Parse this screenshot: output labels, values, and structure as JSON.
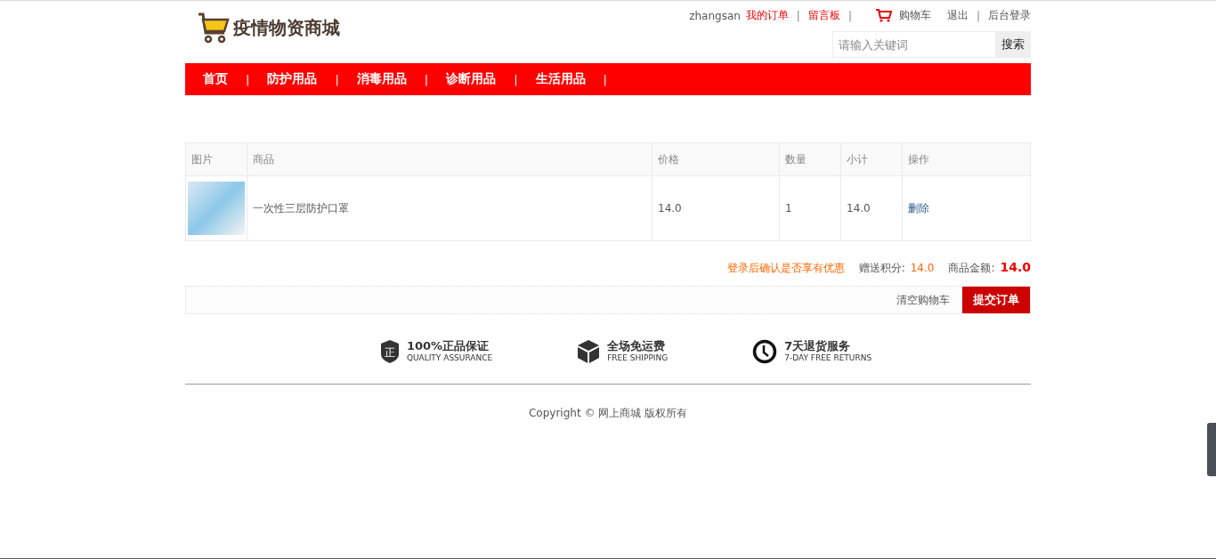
{
  "logo": {
    "title": "疫情物资商城"
  },
  "top_links": [
    {
      "kind": "user",
      "label": "zhangsan"
    },
    {
      "kind": "red",
      "label": "我的订单"
    },
    {
      "kind": "sep",
      "label": "|"
    },
    {
      "kind": "red",
      "label": "留言板"
    },
    {
      "kind": "sep",
      "label": "|"
    },
    {
      "kind": "cart",
      "label": "购物车"
    },
    {
      "kind": "link",
      "label": "退出"
    },
    {
      "kind": "sep",
      "label": "|"
    },
    {
      "kind": "link",
      "label": "后台登录"
    }
  ],
  "search": {
    "placeholder": "请输入关键词",
    "button": "搜索"
  },
  "nav": {
    "separator": "|",
    "items": [
      {
        "label": "首页"
      },
      {
        "label": "防护用品"
      },
      {
        "label": "消毒用品"
      },
      {
        "label": "诊断用品"
      },
      {
        "label": "生活用品"
      }
    ]
  },
  "table": {
    "columns": [
      "图片",
      "商品",
      "价格",
      "数量",
      "小计",
      "操作"
    ],
    "rows": [
      {
        "name": "一次性三层防护口罩",
        "price": "14.0",
        "quantity": "1",
        "subtotal": "14.0",
        "action": "删除"
      }
    ]
  },
  "summary": {
    "notice": "登录后确认是否享有优惠",
    "points_label": "赠送积分:",
    "points": "14.0",
    "total_label": "商品金额:",
    "total": "14.0"
  },
  "actions": {
    "clear": "清空购物车",
    "submit": "提交订单"
  },
  "features": [
    {
      "kind": "quality",
      "icon_text": "正",
      "title": "100%正品保证",
      "subtitle": "QUALITY ASSURANCE"
    },
    {
      "kind": "shipping",
      "title": "全场免运费",
      "subtitle": "FREE SHIPPING"
    },
    {
      "kind": "returns",
      "title": "7天退货服务",
      "subtitle": "7-DAY FREE RETURNS"
    }
  ],
  "footer": {
    "copyright": "Copyright © 网上商城 版权所有"
  }
}
